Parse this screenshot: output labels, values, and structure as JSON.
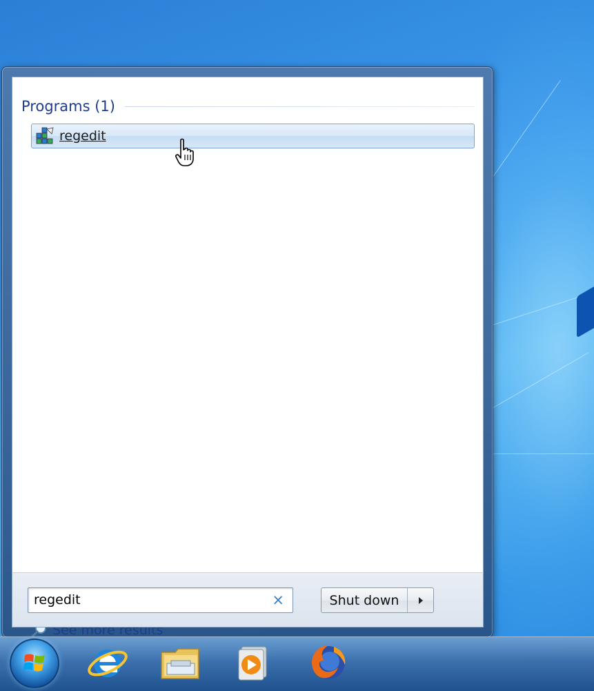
{
  "start_menu": {
    "group_title": "Programs (1)",
    "result": {
      "label": "regedit",
      "icon": "regedit-icon"
    },
    "see_more_label": "See more results",
    "search_value": "regedit",
    "clear_icon": "×",
    "shutdown_label": "Shut down"
  },
  "taskbar": {
    "items": [
      "start-orb",
      "internet-explorer-icon",
      "windows-explorer-icon",
      "media-player-icon",
      "firefox-icon"
    ]
  },
  "colors": {
    "header_blue": "#1e3c8a",
    "selection_border": "#7da2ce"
  }
}
